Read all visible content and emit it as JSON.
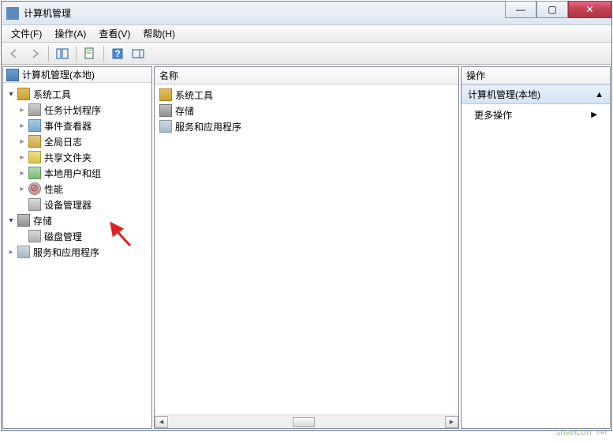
{
  "window": {
    "title": "计算机管理"
  },
  "menu": {
    "file": "文件(F)",
    "action": "操作(A)",
    "view": "查看(V)",
    "help": "帮助(H)"
  },
  "tree": {
    "root": "计算机管理(本地)",
    "system_tools": "系统工具",
    "task_scheduler": "任务计划程序",
    "event_viewer": "事件查看器",
    "global_logs": "全局日志",
    "shared_folders": "共享文件夹",
    "local_users": "本地用户和组",
    "performance": "性能",
    "device_manager": "设备管理器",
    "storage": "存储",
    "disk_mgmt": "磁盘管理",
    "services_apps": "服务和应用程序"
  },
  "center": {
    "header": "名称",
    "items": {
      "system_tools": "系统工具",
      "storage": "存储",
      "services_apps": "服务和应用程序"
    }
  },
  "actions": {
    "header": "操作",
    "section": "计算机管理(本地)",
    "more": "更多操作"
  },
  "watermark": {
    "text": "shancun",
    "sub": ".net"
  }
}
